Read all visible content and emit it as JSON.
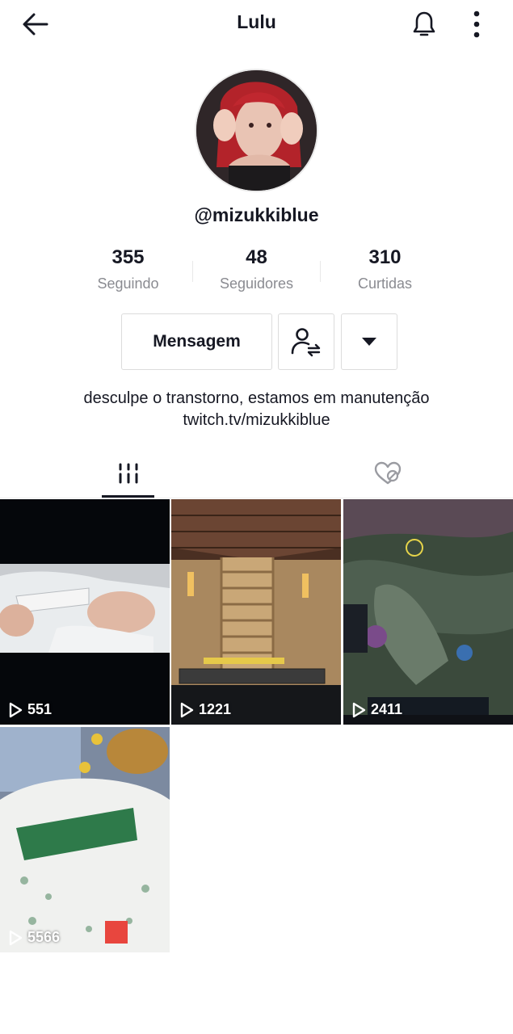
{
  "header": {
    "title": "Lulu",
    "back_icon": "arrow-left-icon",
    "bell_icon": "bell-icon",
    "more_icon": "more-vertical-icon"
  },
  "profile": {
    "handle": "@mizukkiblue",
    "stats": [
      {
        "value": "355",
        "label": "Seguindo"
      },
      {
        "value": "48",
        "label": "Seguidores"
      },
      {
        "value": "310",
        "label": "Curtidas"
      }
    ],
    "actions": {
      "message_label": "Mensagem",
      "follow_icon": "user-swap-icon",
      "dropdown_icon": "caret-down-icon"
    },
    "bio": {
      "line1": "desculpe o transtorno, estamos em manutenção",
      "line2": "twitch.tv/mizukkiblue"
    }
  },
  "tabs": [
    {
      "name": "videos",
      "icon": "grid-columns-icon",
      "active": true
    },
    {
      "name": "liked",
      "icon": "heart-hidden-icon",
      "active": false
    }
  ],
  "videos": [
    {
      "plays": "551"
    },
    {
      "plays": "1221"
    },
    {
      "plays": "2411"
    },
    {
      "plays": "5566"
    }
  ],
  "colors": {
    "text_primary": "#161823",
    "text_secondary": "#8a8b91",
    "border": "#dcdcdc"
  }
}
